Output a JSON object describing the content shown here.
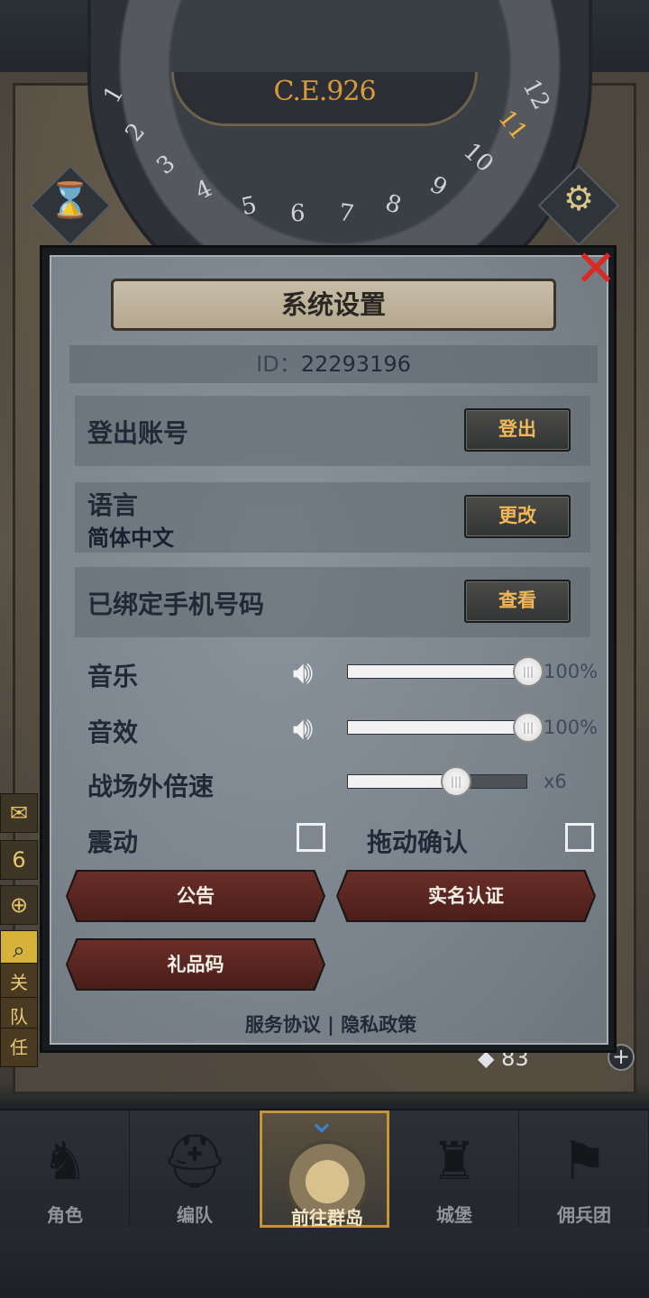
{
  "background": {
    "calendar": {
      "era": "C.E.926",
      "months": [
        "1",
        "2",
        "3",
        "4",
        "5",
        "6",
        "7",
        "8",
        "9",
        "10",
        "11",
        "12"
      ],
      "active_month": "11"
    },
    "hourglass_icon": "hourglass-icon",
    "settings_icon": "gear-icon",
    "side_badge_count": "6",
    "resource_count": "83",
    "side_text": [
      "关",
      "队",
      "任"
    ]
  },
  "dialog": {
    "title": "系统设置",
    "id_label": "ID：",
    "id_value": "22293196",
    "rows": {
      "logout": {
        "label": "登出账号",
        "button": "登出"
      },
      "language": {
        "label": "语言",
        "value": "简体中文",
        "button": "更改"
      },
      "phone": {
        "label": "已绑定手机号码",
        "button": "查看"
      }
    },
    "music": {
      "label": "音乐",
      "percent": 100,
      "value_text": "100%"
    },
    "sfx": {
      "label": "音效",
      "percent": 100,
      "value_text": "100%"
    },
    "battle_speed": {
      "label": "战场外倍速",
      "level": 0.6,
      "value_text": "x6"
    },
    "vibration": {
      "label": "震动",
      "checked": false
    },
    "drag_confirm": {
      "label": "拖动确认",
      "checked": false
    },
    "buttons": {
      "announcement": "公告",
      "real_name": "实名认证",
      "gift_code": "礼品码"
    },
    "footer": {
      "terms": "服务协议",
      "separator": "|",
      "privacy": "隐私政策"
    }
  },
  "bottom_nav": {
    "items": [
      {
        "label": "角色",
        "icon": "knight-icon",
        "active": false
      },
      {
        "label": "编队",
        "icon": "helmet-icon",
        "active": false
      },
      {
        "label": "前往群岛",
        "icon": "globe-icon",
        "active": true
      },
      {
        "label": "城堡",
        "icon": "castle-icon",
        "active": false
      },
      {
        "label": "佣兵团",
        "icon": "banner-icon",
        "active": false
      }
    ]
  },
  "colors": {
    "gold_text": "#f2b857",
    "close_red": "#d82b23",
    "active_tab_border": "#c5953a",
    "era_text": "#d99a3a"
  }
}
